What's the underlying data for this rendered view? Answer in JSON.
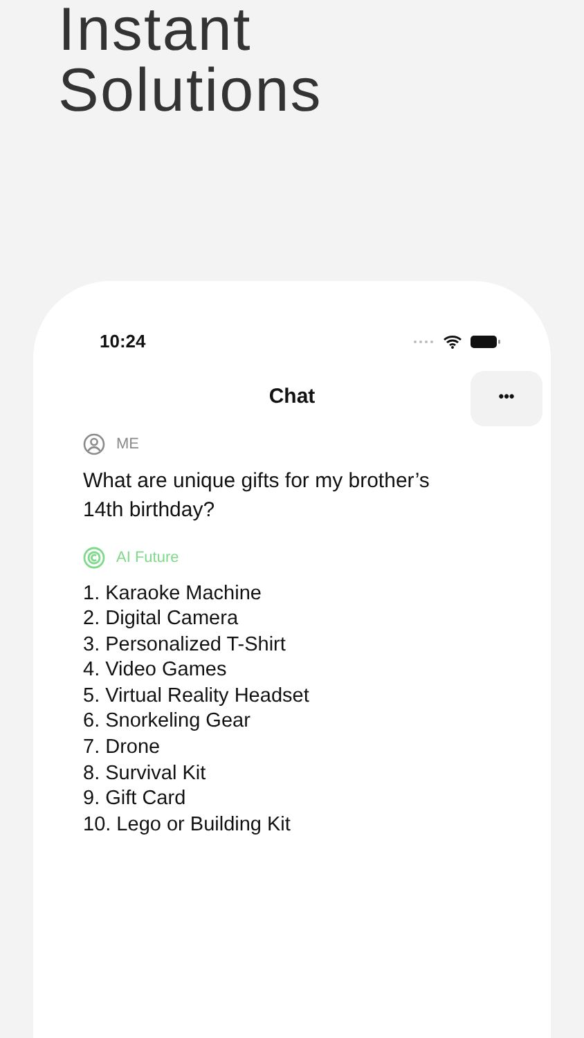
{
  "headline": [
    "Instant",
    "Solutions"
  ],
  "status_bar": {
    "time": "10:24"
  },
  "nav": {
    "title": "Chat",
    "menu_label": "•••"
  },
  "messages": [
    {
      "kind": "user",
      "sender": "ME",
      "text": "What are unique gifts for my brother’s 14th birthday?"
    },
    {
      "kind": "assistant",
      "sender": "AI Future",
      "items": [
        "1. Karaoke Machine",
        "2. Digital Camera",
        "3. Personalized T-Shirt",
        "4. Video Games",
        "5. Virtual Reality Headset",
        "6. Snorkeling Gear",
        "7. Drone",
        "8. Survival Kit",
        "9. Gift Card",
        "10. Lego or Building Kit"
      ]
    }
  ]
}
